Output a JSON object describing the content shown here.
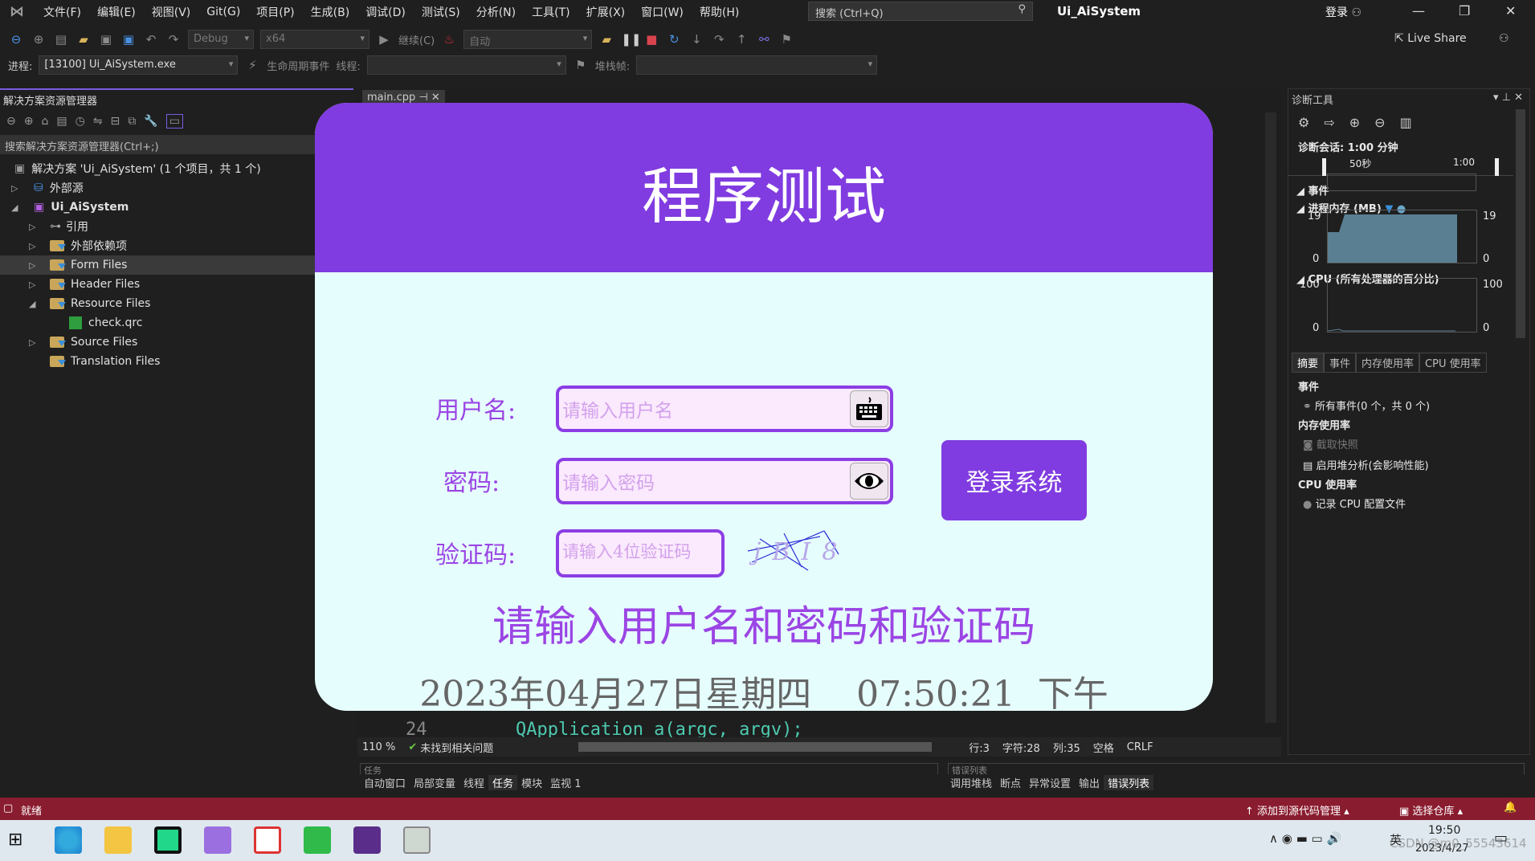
{
  "menubar": {
    "items": [
      "文件(F)",
      "编辑(E)",
      "视图(V)",
      "Git(G)",
      "项目(P)",
      "生成(B)",
      "调试(D)",
      "测试(S)",
      "分析(N)",
      "工具(T)",
      "扩展(X)",
      "窗口(W)",
      "帮助(H)"
    ],
    "search_placeholder": "搜索 (Ctrl+Q)",
    "title": "Ui_AiSystem",
    "login": "登录"
  },
  "toolbar": {
    "config": "Debug",
    "platform": "x64",
    "continue": "继续(C)",
    "auto": "自动",
    "live_share": "Live Share",
    "process_label": "进程:",
    "process": "[13100] Ui_AiSystem.exe",
    "lifecycle": "生命周期事件",
    "thread_label": "线程:",
    "stack_label": "堆栈帧:"
  },
  "solution_explorer": {
    "title": "解决方案资源管理器",
    "search": "搜索解决方案资源管理器(Ctrl+;)",
    "items": [
      {
        "label": "解决方案 'Ui_AiSystem' (1 个项目，共 1 个)"
      },
      {
        "label": "外部源"
      },
      {
        "label": "Ui_AiSystem"
      },
      {
        "label": "引用"
      },
      {
        "label": "外部依赖项"
      },
      {
        "label": "Form Files"
      },
      {
        "label": "Header Files"
      },
      {
        "label": "Resource Files"
      },
      {
        "label": "check.qrc"
      },
      {
        "label": "Source Files"
      },
      {
        "label": "Translation Files"
      }
    ]
  },
  "editor": {
    "tab": "main.cpp",
    "line_number": "24",
    "code": "QApplication a(argc, argv);",
    "zoom": "110 %",
    "issues": "未找到相关问题",
    "line": "行:3",
    "char": "字符:28",
    "col": "列:35",
    "spaces": "空格",
    "eol": "CRLF"
  },
  "diagnostics": {
    "title": "诊断工具",
    "session": "诊断会话: 1:00 分钟",
    "tick1": "50秒",
    "tick2": "1:00",
    "events": "事件",
    "memory": "进程内存 (MB)",
    "mem_max": "19",
    "mem_min": "0",
    "cpu": "CPU (所有处理器的百分比)",
    "cpu_max": "100",
    "cpu_min": "0",
    "tabs": [
      "摘要",
      "事件",
      "内存使用率",
      "CPU 使用率"
    ],
    "sec_events": "事件",
    "all_events": "所有事件(0 个，共 0 个)",
    "sec_memory": "内存使用率",
    "snapshot": "截取快照",
    "heap": "启用堆分析(会影响性能)",
    "sec_cpu": "CPU 使用率",
    "record_cpu": "记录 CPU 配置文件"
  },
  "bottom": {
    "left_title": "任务",
    "right_title": "错误列表",
    "left_tabs": [
      "自动窗口",
      "局部变量",
      "线程",
      "任务",
      "模块",
      "监视 1"
    ],
    "right_tabs": [
      "调用堆栈",
      "断点",
      "异常设置",
      "输出",
      "错误列表"
    ]
  },
  "status": {
    "ready": "就绪",
    "source_control": "添加到源代码管理",
    "repo": "选择仓库"
  },
  "taskbar": {
    "time": "19:50",
    "date": "2023/4/27",
    "ime": "英",
    "watermark": "CSDN @m0_55543614"
  },
  "dialog": {
    "title": "程序测试",
    "username_label": "用户名:",
    "username_placeholder": "请输入用户名",
    "password_label": "密码:",
    "password_placeholder": "请输入密码",
    "captcha_label": "验证码:",
    "captcha_placeholder": "请输入4位验证码",
    "captcha_text": "jBI8",
    "login": "登录系统",
    "message": "请输入用户名和密码和验证码",
    "datetime": "2023年04月27日星期四    07:50:21  下午",
    "accent": "#803ce0",
    "background": "#e6fdfd"
  }
}
